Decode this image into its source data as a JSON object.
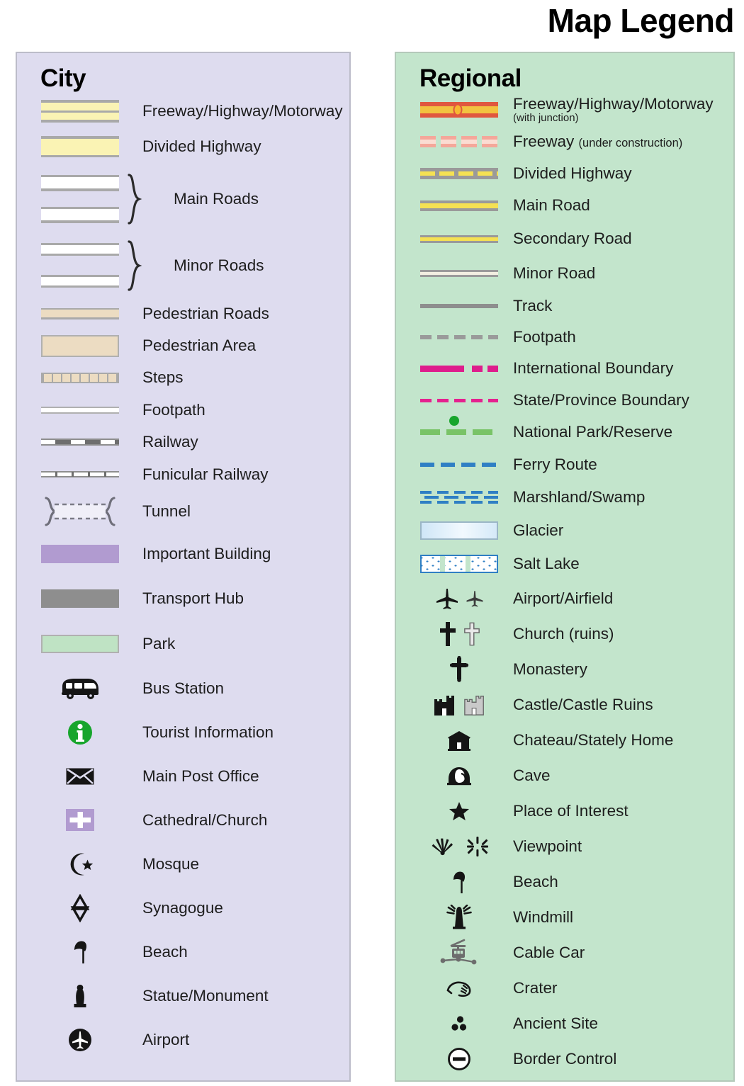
{
  "title": "Map Legend",
  "colors": {
    "city_panel_bg": "#dedcef",
    "regional_panel_bg": "#c3e5cc",
    "freeway_yellow": "#faf3b4",
    "pedestrian_tan": "#ecdcc2",
    "important_building_purple": "#b19bd0",
    "transport_hub_grey": "#8e8e8e",
    "park_green": "#bfe3c4",
    "regional_freeway_red": "#e0573f",
    "regional_road_yellow": "#f5e153",
    "boundary_magenta": "#de1d8c",
    "ferry_blue": "#2f7fc4",
    "national_park_green": "#79c367",
    "tourist_info_green": "#17a52c"
  },
  "city": {
    "heading": "City",
    "items": [
      {
        "label": "Freeway/Highway/Motorway",
        "symbol": "freeway-bar"
      },
      {
        "label": "Divided Highway",
        "symbol": "divided-highway-bar"
      },
      {
        "label": "Main Roads",
        "symbol": "main-roads-bars-with-brace"
      },
      {
        "label": "Minor Roads",
        "symbol": "minor-roads-bars-with-brace"
      },
      {
        "label": "Pedestrian Roads",
        "symbol": "pedestrian-road-bar"
      },
      {
        "label": "Pedestrian Area",
        "symbol": "pedestrian-area-bar"
      },
      {
        "label": "Steps",
        "symbol": "steps-bar"
      },
      {
        "label": "Footpath",
        "symbol": "footpath-line"
      },
      {
        "label": "Railway",
        "symbol": "railway-line"
      },
      {
        "label": "Funicular Railway",
        "symbol": "funicular-railway-line"
      },
      {
        "label": "Tunnel",
        "symbol": "tunnel-bracket"
      },
      {
        "label": "Important Building",
        "symbol": "important-building-swatch"
      },
      {
        "label": "Transport Hub",
        "symbol": "transport-hub-swatch"
      },
      {
        "label": "Park",
        "symbol": "park-swatch"
      },
      {
        "label": "Bus Station",
        "symbol": "bus-icon"
      },
      {
        "label": "Tourist Information",
        "symbol": "tourist-information-icon"
      },
      {
        "label": "Main Post Office",
        "symbol": "envelope-icon"
      },
      {
        "label": "Cathedral/Church",
        "symbol": "cathedral-cross-icon"
      },
      {
        "label": "Mosque",
        "symbol": "crescent-star-icon"
      },
      {
        "label": "Synagogue",
        "symbol": "star-of-david-icon"
      },
      {
        "label": "Beach",
        "symbol": "beach-umbrella-icon"
      },
      {
        "label": "Statue/Monument",
        "symbol": "statue-icon"
      },
      {
        "label": "Airport",
        "symbol": "airport-circle-icon"
      }
    ]
  },
  "regional": {
    "heading": "Regional",
    "items": [
      {
        "label": "Freeway/Highway/Motorway",
        "sublabel": "(with junction)",
        "symbol": "regional-freeway-junction-line"
      },
      {
        "label": "Freeway",
        "sublabel_inline": "(under construction)",
        "symbol": "freeway-under-construction-line"
      },
      {
        "label": "Divided Highway",
        "symbol": "regional-divided-highway-line"
      },
      {
        "label": "Main Road",
        "symbol": "regional-main-road-line"
      },
      {
        "label": "Secondary Road",
        "symbol": "regional-secondary-road-line"
      },
      {
        "label": "Minor Road",
        "symbol": "regional-minor-road-line"
      },
      {
        "label": "Track",
        "symbol": "track-line"
      },
      {
        "label": "Footpath",
        "symbol": "regional-footpath-line"
      },
      {
        "label": "International Boundary",
        "symbol": "international-boundary-line"
      },
      {
        "label": "State/Province Boundary",
        "symbol": "state-boundary-line"
      },
      {
        "label": "National Park/Reserve",
        "symbol": "national-park-line"
      },
      {
        "label": "Ferry Route",
        "symbol": "ferry-route-line"
      },
      {
        "label": "Marshland/Swamp",
        "symbol": "marshland-pattern"
      },
      {
        "label": "Glacier",
        "symbol": "glacier-swatch"
      },
      {
        "label": "Salt Lake",
        "symbol": "salt-lake-swatch"
      },
      {
        "label": "Airport/Airfield",
        "symbol": "airplane-icon"
      },
      {
        "label": "Church (ruins)",
        "symbol": "church-cross-icon"
      },
      {
        "label": "Monastery",
        "symbol": "monastery-cross-icon"
      },
      {
        "label": "Castle/Castle Ruins",
        "symbol": "castle-icon"
      },
      {
        "label": "Chateau/Stately Home",
        "symbol": "chateau-icon"
      },
      {
        "label": "Cave",
        "symbol": "cave-icon"
      },
      {
        "label": "Place of Interest",
        "symbol": "star-icon"
      },
      {
        "label": "Viewpoint",
        "symbol": "viewpoint-icon"
      },
      {
        "label": "Beach",
        "symbol": "beach-umbrella-icon"
      },
      {
        "label": "Windmill",
        "symbol": "windmill-icon"
      },
      {
        "label": "Cable Car",
        "symbol": "cable-car-icon"
      },
      {
        "label": "Crater",
        "symbol": "crater-icon"
      },
      {
        "label": "Ancient Site",
        "symbol": "ancient-site-icon"
      },
      {
        "label": "Border Control",
        "symbol": "border-control-icon"
      }
    ]
  }
}
